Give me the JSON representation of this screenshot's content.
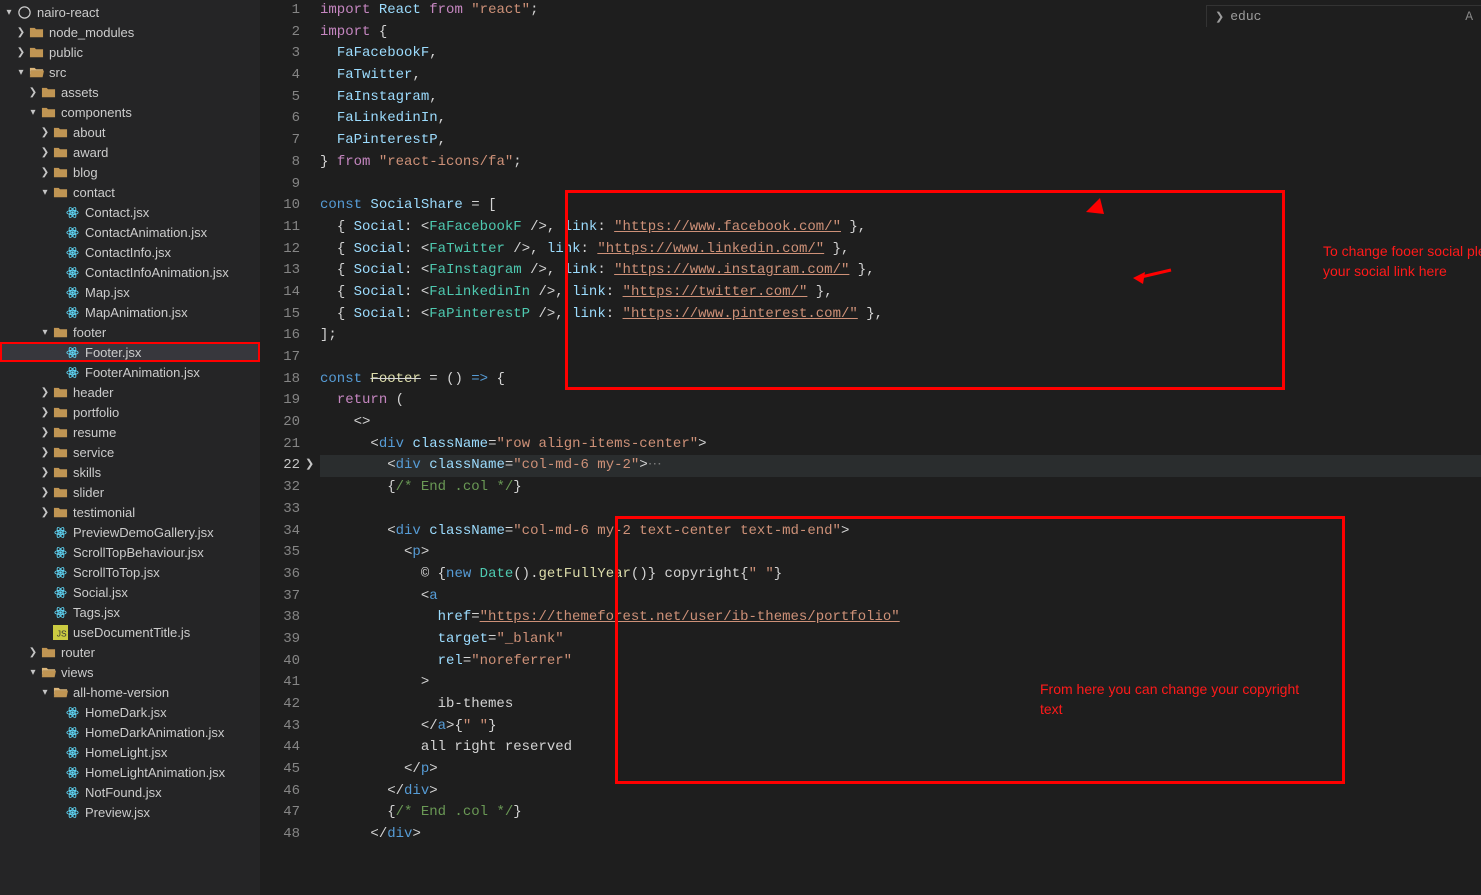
{
  "breadcrumb": {
    "label": "educ",
    "trail": "A"
  },
  "annotations": {
    "note1": "To change fooer social pleae replace your social link here",
    "note2": "From here you can change your copyright text"
  },
  "sidebar": {
    "items": [
      {
        "depth": 0,
        "tw": "v",
        "icon": "circle",
        "label": "nairo-react"
      },
      {
        "depth": 1,
        "tw": ">",
        "icon": "folder",
        "label": "node_modules"
      },
      {
        "depth": 1,
        "tw": ">",
        "icon": "folder",
        "label": "public"
      },
      {
        "depth": 1,
        "tw": "v",
        "icon": "folder-open",
        "label": "src"
      },
      {
        "depth": 2,
        "tw": ">",
        "icon": "folder",
        "label": "assets"
      },
      {
        "depth": 2,
        "tw": "v",
        "icon": "folder",
        "label": "components"
      },
      {
        "depth": 3,
        "tw": ">",
        "icon": "folder",
        "label": "about"
      },
      {
        "depth": 3,
        "tw": ">",
        "icon": "folder",
        "label": "award"
      },
      {
        "depth": 3,
        "tw": ">",
        "icon": "folder",
        "label": "blog"
      },
      {
        "depth": 3,
        "tw": "v",
        "icon": "folder",
        "label": "contact"
      },
      {
        "depth": 4,
        "tw": "",
        "icon": "react",
        "label": "Contact.jsx"
      },
      {
        "depth": 4,
        "tw": "",
        "icon": "react",
        "label": "ContactAnimation.jsx"
      },
      {
        "depth": 4,
        "tw": "",
        "icon": "react",
        "label": "ContactInfo.jsx"
      },
      {
        "depth": 4,
        "tw": "",
        "icon": "react",
        "label": "ContactInfoAnimation.jsx"
      },
      {
        "depth": 4,
        "tw": "",
        "icon": "react",
        "label": "Map.jsx"
      },
      {
        "depth": 4,
        "tw": "",
        "icon": "react",
        "label": "MapAnimation.jsx"
      },
      {
        "depth": 3,
        "tw": "v",
        "icon": "folder",
        "label": "footer"
      },
      {
        "depth": 4,
        "tw": "",
        "icon": "react",
        "label": "Footer.jsx",
        "selected": true,
        "boxed": true
      },
      {
        "depth": 4,
        "tw": "",
        "icon": "react",
        "label": "FooterAnimation.jsx"
      },
      {
        "depth": 3,
        "tw": ">",
        "icon": "folder",
        "label": "header"
      },
      {
        "depth": 3,
        "tw": ">",
        "icon": "folder",
        "label": "portfolio"
      },
      {
        "depth": 3,
        "tw": ">",
        "icon": "folder",
        "label": "resume"
      },
      {
        "depth": 3,
        "tw": ">",
        "icon": "folder",
        "label": "service"
      },
      {
        "depth": 3,
        "tw": ">",
        "icon": "folder",
        "label": "skills"
      },
      {
        "depth": 3,
        "tw": ">",
        "icon": "folder",
        "label": "slider"
      },
      {
        "depth": 3,
        "tw": ">",
        "icon": "folder",
        "label": "testimonial"
      },
      {
        "depth": 3,
        "tw": "",
        "icon": "react",
        "label": "PreviewDemoGallery.jsx"
      },
      {
        "depth": 3,
        "tw": "",
        "icon": "react",
        "label": "ScrollTopBehaviour.jsx"
      },
      {
        "depth": 3,
        "tw": "",
        "icon": "react",
        "label": "ScrollToTop.jsx"
      },
      {
        "depth": 3,
        "tw": "",
        "icon": "react",
        "label": "Social.jsx"
      },
      {
        "depth": 3,
        "tw": "",
        "icon": "react",
        "label": "Tags.jsx"
      },
      {
        "depth": 3,
        "tw": "",
        "icon": "js",
        "label": "useDocumentTitle.js"
      },
      {
        "depth": 2,
        "tw": ">",
        "icon": "folder",
        "label": "router"
      },
      {
        "depth": 2,
        "tw": "v",
        "icon": "folder-open",
        "label": "views"
      },
      {
        "depth": 3,
        "tw": "v",
        "icon": "folder-open",
        "label": "all-home-version"
      },
      {
        "depth": 4,
        "tw": "",
        "icon": "react",
        "label": "HomeDark.jsx"
      },
      {
        "depth": 4,
        "tw": "",
        "icon": "react",
        "label": "HomeDarkAnimation.jsx"
      },
      {
        "depth": 4,
        "tw": "",
        "icon": "react",
        "label": "HomeLight.jsx"
      },
      {
        "depth": 4,
        "tw": "",
        "icon": "react",
        "label": "HomeLightAnimation.jsx"
      },
      {
        "depth": 4,
        "tw": "",
        "icon": "react",
        "label": "NotFound.jsx"
      },
      {
        "depth": 4,
        "tw": "",
        "icon": "react",
        "label": "Preview.jsx"
      }
    ]
  },
  "code": {
    "lineNumbers": [
      1,
      2,
      3,
      4,
      5,
      6,
      7,
      8,
      9,
      10,
      11,
      12,
      13,
      14,
      15,
      16,
      17,
      18,
      19,
      20,
      21,
      22,
      32,
      33,
      34,
      35,
      36,
      37,
      38,
      39,
      40,
      41,
      42,
      43,
      44,
      45,
      46,
      47,
      48
    ],
    "tokens": {
      "import": "import",
      "React": "React",
      "from": "from",
      "reactStr": "\"react\"",
      "FaFacebookF": "FaFacebookF",
      "FaTwitter": "FaTwitter",
      "FaInstagram": "FaInstagram",
      "FaLinkedinIn": "FaLinkedinIn",
      "FaPinterestP": "FaPinterestP",
      "reactIcons": "\"react-icons/fa\"",
      "const": "const",
      "SocialShare": "SocialShare",
      "Social": "Social",
      "link": "link",
      "fb": "\"https://www.facebook.com/\"",
      "li": "\"https://www.linkedin.com/\"",
      "ig": "\"https://www.instagram.com/\"",
      "tw": "\"https://twitter.com/\"",
      "pin": "\"https://www.pinterest.com/\"",
      "Footer": "Footer",
      "return": "return",
      "div": "div",
      "className": "className",
      "row": "\"row align-items-center\"",
      "col1": "\"col-md-6 my-2\"",
      "endcol": "/* End .col */",
      "col2": "\"col-md-6 my-2 text-center text-md-end\"",
      "p": "p",
      "copy": "© ",
      "new": "new",
      "Date": "Date",
      "getFullYear": "getFullYear",
      "copyright": " copyright",
      "spc": "\" \"",
      "a": "a",
      "href": "href",
      "themef": "\"https://themeforest.net/user/ib-themes/portfolio\"",
      "target": "target",
      "blank": "\"_blank\"",
      "rel": "rel",
      "noref": "\"noreferrer\"",
      "ibthemes": "ib-themes",
      "allrights": "all right reserved"
    }
  }
}
